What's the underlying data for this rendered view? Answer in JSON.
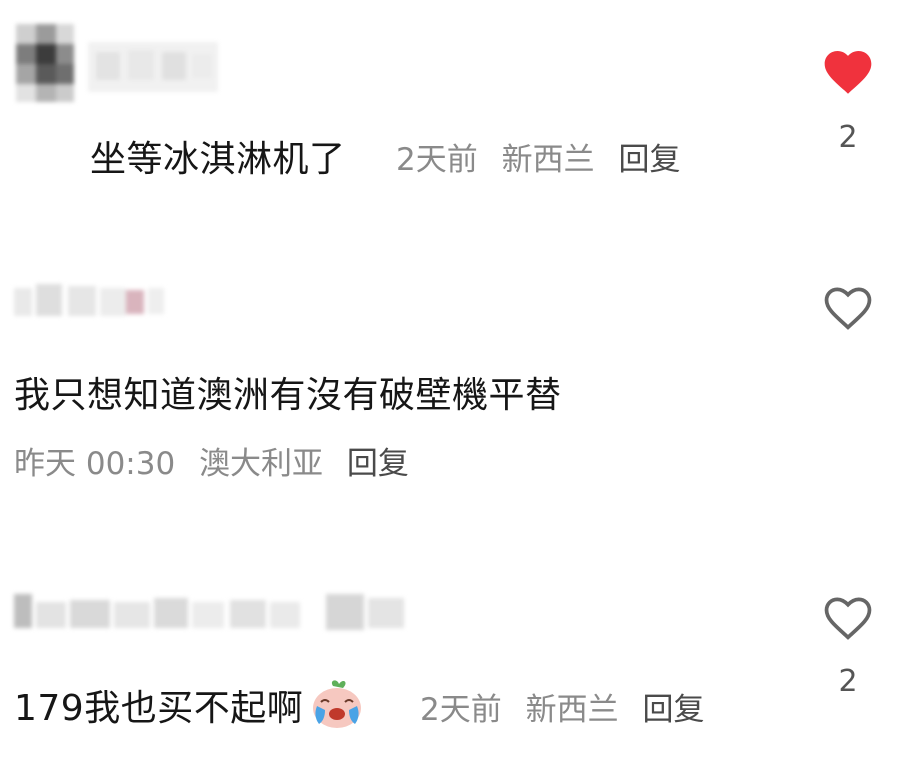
{
  "comments": [
    {
      "text": "坐等冰淇淋机了",
      "time": "2天前",
      "location": "新西兰",
      "reply_label": "回复",
      "liked": true,
      "like_count": "2"
    },
    {
      "text": "我只想知道澳洲有沒有破壁機平替",
      "time": "昨天 00:30",
      "location": "澳大利亚",
      "reply_label": "回复",
      "liked": false,
      "like_count": ""
    },
    {
      "text": "179我也买不起啊",
      "time": "2天前",
      "location": "新西兰",
      "reply_label": "回复",
      "liked": false,
      "like_count": "2",
      "emoji": "crying-laughing-peach-emoji"
    }
  ],
  "colors": {
    "like_active": "#f0323d",
    "like_inactive": "#666666",
    "meta_gray": "#8a8a8a",
    "reply_dark": "#4a4a4a"
  },
  "icons": [
    "heart-filled-icon",
    "heart-outline-icon"
  ]
}
